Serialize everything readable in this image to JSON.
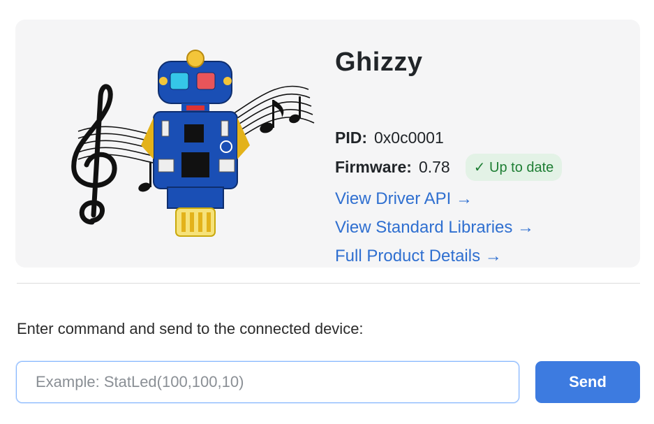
{
  "device": {
    "name": "Ghizzy",
    "pid_label": "PID:",
    "pid_value": "0x0c0001",
    "firmware_label": "Firmware:",
    "firmware_value": "0.78",
    "status_badge": "✓ Up to date",
    "image": "robot-circuit-board-with-music-notes"
  },
  "links": {
    "driver_api": "View Driver API →",
    "standard_libraries": "View Standard Libraries →",
    "product_details": "Full Product Details →"
  },
  "command": {
    "prompt": "Enter command and send to the connected device:",
    "placeholder": "Example: StatLed(100,100,10)",
    "value": "",
    "send_label": "Send"
  },
  "colors": {
    "card_bg": "#f5f5f6",
    "link": "#2f6fd0",
    "badge_bg": "#e3f2e6",
    "badge_text": "#1e7e34",
    "button": "#3d7be0",
    "input_focus_border": "#86b7fe"
  }
}
